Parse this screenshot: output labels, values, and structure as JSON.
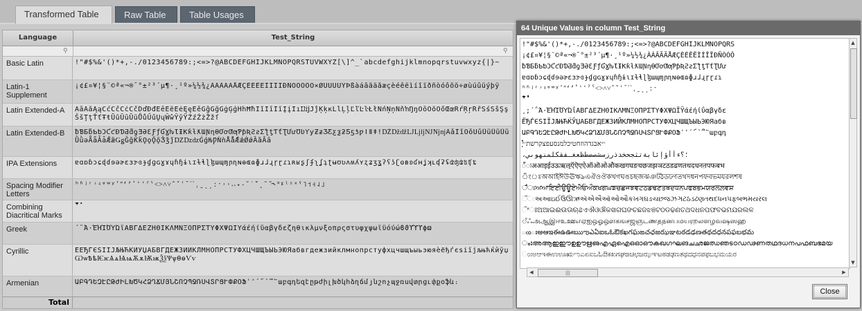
{
  "tabs": [
    {
      "label": "Transformed Table",
      "active": true
    },
    {
      "label": "Raw Table",
      "active": false
    },
    {
      "label": "Table Usages",
      "active": false
    }
  ],
  "grid": {
    "columns": [
      "Language",
      "Test_String"
    ],
    "rows": [
      {
        "language": "Basic Latin",
        "value": "!\"#$%&'()*+,-./0123456789:;<=>?@ABCDEFGHIJKLMNOPQRSTUVWXYZ[\\]^_`abcdefghijklmnopqrstuvwxyz{|}~"
      },
      {
        "language": "Latin-1 Supplement",
        "value": "¡¢£¤¥¦§¨©ª«¬®¯°±²³´µ¶·¸¹º»¼½¾¿ÀÁÂÃÄÅÆÇÈÉÊËÌÍÎÏÐÑÒÓÔÕÖ×ØÙÚÛÜÝÞßàáâãäåæçèéêëìíîïðñòóôõö÷øùúûüýþÿ"
      },
      {
        "language": "Latin Extended-A",
        "value": "ĀāĂăĄąĆćĈĉĊċČčĎďĐđĒēĔĕĖėĘęĚěĜĝĞğĠġĢģĤĥĦħĨĩĪīĬĭĮįİıĲĳĴĵĶķĸĹĺĻļĽľĿŀŁłŃńŅņŇňŉŊŋŌōŎŏŐőŒœŔŕŖŗŘřŚśŜŝŞşŠšŢţŤťŦŧŨũŪūŬŭŮůŰűŲųŴŵŶŷŸŹźŻżŽžſ"
      },
      {
        "language": "Latin Extended-B",
        "value": "ƀƁƂƃƄƅƆƇƈƉƊƋƌƍƎƏƐƑƒƓƔƕƖƗƘƙƚƛƜƝƞƟƠơƢƣƤƥƦƧƨƩƪƫƬƭƮƯưƱƲƳƴƵƶƷƸƹƺƻƼƽƾƿǀǁǂǃǄǅǆǇǈǉǊǋǌǍǎǏǐǑǒǓǔǕǖǗǘǙǚǛǜǝǞǟǠǡǢǣǤǥǦǧǨǩǪǫǬǭǮǯǰǱǲǳǴǵǶǷǸǹǺǻǼǽǾǿȀȁȂȃ"
      },
      {
        "language": "IPA Extensions",
        "value": "ɐɑɒɓɔɕɖɗɘəɚɛɜɝɞɟɠɡɢɣɤɥɦɧɨɩɪɫɬɭɮɯɰɱɲɳɴɵɶɷɸɹɺɻɼɽɾɿʀʁʂʃʄʅʆʇʈʉʊʋʌʍʎʏʐʑʒʓʔʕʖʗʘʙʚʛʜʝʞʟʠʡʢʣʤʥʦʧʨ"
      },
      {
        "language": "Spacing Modifier Letters",
        "value": "ʰʱʲʳʴʵʶʷʸʹʺʻʼʽʾʿˀˁ˂˃˄˅ˆˇˈˉˊˋˌˍˎˏːˑ˒˓˔˕˖˗˘˙˚˛˜˝˞˟ˠˡˢˣˤ˥˦˧˨˩"
      },
      {
        "language": "Combining Diacritical Marks",
        "value": "̀́̂̃̄̅̆̇̈̉̊̋̌̍̎̏̐̑̒̓̔̕̚"
      },
      {
        "language": "Greek",
        "value": "΄΅Ά·ΈΉΊΌΎΏΐΑΒΓΔΕΖΗΘΙΚΛΜΝΞΟΠΡΣΤΥΦΧΨΩΪΫάέήίΰαβγδεζηθικλμνξοπρςστυφχψωϊϋόύώϐϑϒϓϔϕϖ"
      },
      {
        "language": "Cyrillic",
        "value": "ЀЁЂЃЄЅІЇЈЉЊЋЌЍЎЏАБВГДЕЖЗИЙКЛМНОПРСТУФХЦЧШЩЪЫЬЭЮЯабвгдежзийклмнопрстуфхцчшщъыьэюяѐёђѓєѕіїјљњћќѝўџѠѡѢѣѤѥѦѧѨѩѪѫѬѭѮѯѰѱѲѳѴѵ"
      },
      {
        "language": "Armenian",
        "value": "ԱԲԳԴԵԶԷԸԹԺԻԼԽԾԿՀՁՂՃՄՅՆՇՈՉՊՋՌՍՎՏՐՑՒՓՔՕՖՙ՚՛՜՝՞՟աբգդեզէըթժիլխծկհձղճմյնշոչպջռսվտրցւփքօֆև։"
      },
      {
        "language": "",
        "value": "֑֖֚֒֓֔֕֗֘֙"
      }
    ],
    "total_label": "Total"
  },
  "dialog": {
    "title": "64 Unique Values in column Test_String",
    "values": [
      "!\"#$%&'()*+,-./0123456789:;<=>?@ABCDEFGHIJKLMNOPQRS",
      "¡¢£¤¥¦§¨©ª«¬®¯°±²³´µ¶·¸¹º»¼½¾¿ÀÁÂÃÄÅÆÇÈÉÊËÌÍÎÏÐÑÒÓÔ",
      "ƀƁƂƃƄƅƆƇƈƉƊƋƌƍƎƏƐƑƒƓƔƕƖƗƘƙƚƛƜƝƞƟƠơƢƣƤƥƦƧƨƩƪƫƬƭƮƯư",
      "ɐɑɒɓɔɕɖɗɘəɚɛɜɝɞɟɠɡɢɣɤɥɦɧɨɩɪɫɬɭɮɯɰɱɲɳɴɵɶɷɸɹɺɻɼɽɾɿ",
      "ʰʱʲʳʴʵʶʷʸʹʺʻʼʽʾʿˀˁ˂˃˄˅ˆˇˈˉˊˋˌˍˎˏːˑ",
      "̀́̂̃̄̅̆̇̈̉̊̋̌̍̎̏̐̑̒̓̔̕̚",
      "͵;΄΅Ά·ΈΉΊΌΎΏΐΑΒΓΔΕΖΗΘΙΚΛΜΝΞΟΠΡΣΤΥΦΧΨΩΪΫάέήίΰαβγδε",
      "ЁЂЃЄЅІЇЈЉЊЋЌЎЏАБВГДЕЖЗИЙКЛМНОПРСТУФХЦЧШЩЪЫЬЭЮЯабв",
      "ԱԲԳԴԵԶԷԸԹԺԻԼԽԾԿՀՁՂՃՄՅՆՇՈՉՊՋՌՍՎՏՐՑՒՓՔՕՖՙ՚՛՜՝՞՟աբգդ",
      "֑֖֚֒֓֔֕֗֘֙׳״אבגדהוזחטיכלמנסעפצקרשת׳״",
      "،؛؟ءآأؤإئابةتثجحخدذرزسشصضطظعغـفقكلمنهوىي",
      "ँंःअआइईउऊऋऌऍऎएऐऑऒओऔकखगघङचछजझञटठडढणतथदधनऩपफबभ",
      "ঁংঃঅআইঈউঊঋঌএঐওঔকখগঘঙচছজঝঞটঠডঢণতথদধনপফবভমযরলশষ",
      "ਁਂਃਅਆਇਈਉਊਏਐਓਔਕਖਗਘਙਚਛਜਝਞਟਠਡਢਣਤਥਦਧਨਪਫਬਭਮਯਰਲਲ਼ਵਸ਼",
      "ઁંઃઅઆઇઈઉઊઋઍએઐઑઓઔકખગઘઙચછજઝઞટઠડઢણતથદધનપફબભમયરલ",
      "ଁଂଃଅଆଇଈଉଊଋଌଏଐଓଔକଖଗଘଙଚଛଜଝଞଟଠଡଢଣତଥଦଧନପଫବଭମଯରଲଳ",
      "ஂஃஅஆஇஈஉஊஎஏஐஒஓஔகஙசஜஞடணதநனபமயரறலளழவஷஸஹ",
      "ఁంఃఅఆఇఈఉఊఋఌఎఏఐఒఓఔకఖగఘఙచఛజఝఞటఠడఢణతథదధనపఫబభమ",
      "ംഃഅആഇഈഉഊഋഌഎഏഐഒഓഔകഖഗഘങചഛജഝഞടഠഡഢണതഥദധനപഫബഭമയ",
      "ಂಃಅಆಇಈಉಊಋಌಎಏಐಒಓಔಕಖಗಘಙಚಛಜಝಞಟಠಡಢಣತಥದಧನಪಫಬಭಮಯರ"
    ],
    "close_label": "Close"
  }
}
